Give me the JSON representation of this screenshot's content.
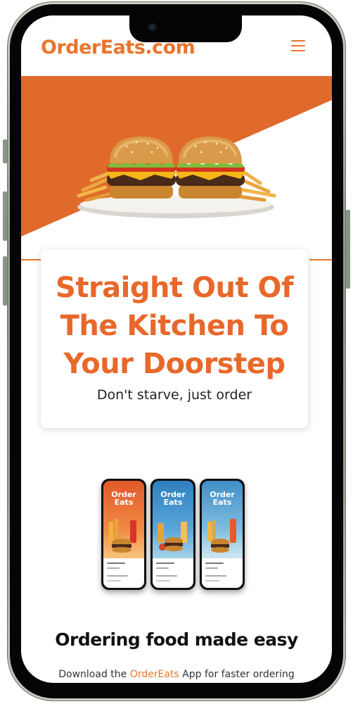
{
  "header": {
    "logo": "OrderEats.com",
    "menu_icon": "hamburger-menu-icon"
  },
  "hero": {
    "image": "burgers-on-plate",
    "headline": "Straight Out Of The Kitchen To Your Doorstep",
    "tagline": "Don't starve, just order"
  },
  "app_promo": {
    "mockups": [
      {
        "title": "Order Eats",
        "theme": "orange"
      },
      {
        "title": "Order Eats",
        "theme": "blue"
      },
      {
        "title": "Order Eats",
        "theme": "light-blue"
      }
    ],
    "title": "Ordering food made easy",
    "subtitle_before": "Download the ",
    "subtitle_brand": "OrderEats",
    "subtitle_after": " App for faster ordering"
  },
  "colors": {
    "brand": "#e8752d",
    "headline": "#e8682a",
    "hero_band": "#e06a2c"
  }
}
